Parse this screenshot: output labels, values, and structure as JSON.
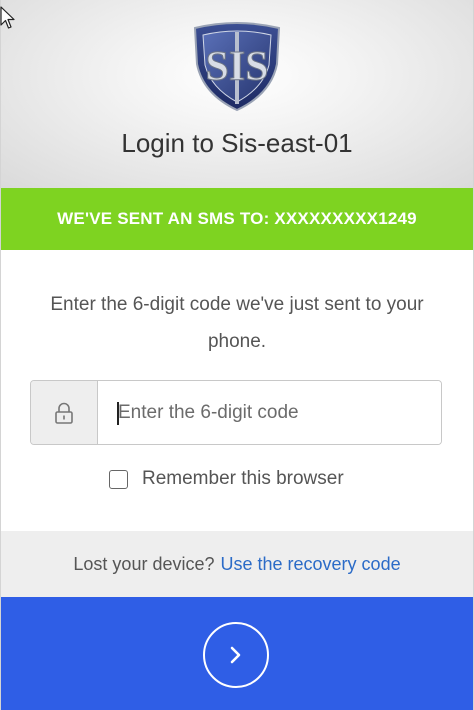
{
  "header": {
    "logo_text": "SIS",
    "title": "Login to Sis-east-01"
  },
  "banner": {
    "text": "WE'VE SENT AN SMS TO: XXXXXXXXX1249"
  },
  "instruction": {
    "text": "Enter the 6-digit code we've just sent to your phone."
  },
  "code_field": {
    "placeholder": "Enter the 6-digit code",
    "value": "",
    "icon": "lock-icon"
  },
  "remember": {
    "label": "Remember this browser",
    "checked": false
  },
  "recovery": {
    "prompt": "Lost your device?",
    "link_label": "Use the recovery code"
  },
  "submit": {
    "icon": "chevron-right-icon"
  },
  "colors": {
    "banner": "#7ed321",
    "submit_bar": "#2f5ee6",
    "link": "#2b6bc7",
    "recovery_bar": "#eeeeee"
  }
}
